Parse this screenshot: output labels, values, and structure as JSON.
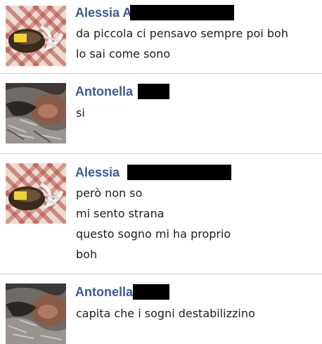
{
  "colors": {
    "sender_name": "#3b5998",
    "message_text": "#1c1c1c",
    "divider": "#d6d6d6",
    "redaction": "#000000"
  },
  "messages": [
    {
      "sender": "Alessia A",
      "avatar": "alessia-avatar",
      "lines": [
        "da piccola ci pensavo sempre poi boh",
        "lo sai come sono"
      ]
    },
    {
      "sender": "Antonella",
      "avatar": "antonella-avatar",
      "lines": [
        "si"
      ]
    },
    {
      "sender": "Alessia",
      "avatar": "alessia-avatar",
      "lines": [
        "però non so",
        "mi sento strana",
        "questo sogno mi ha proprio",
        "boh"
      ]
    },
    {
      "sender": "Antonella",
      "avatar": "antonella-avatar",
      "lines": [
        "capita che i sogni destabilizzino"
      ]
    }
  ]
}
